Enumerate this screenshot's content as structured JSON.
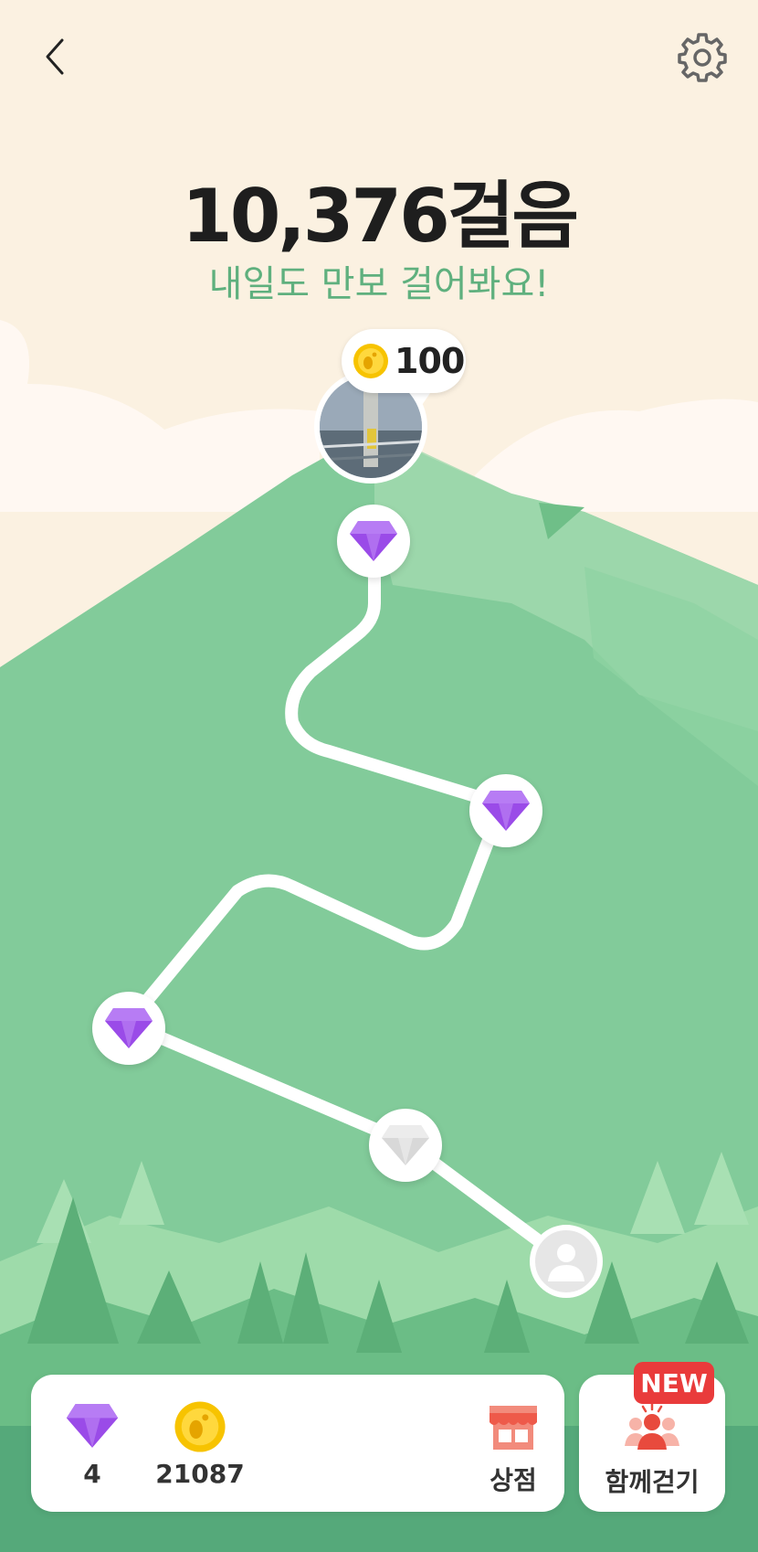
{
  "header": {
    "steps": "10,376걸음",
    "subtitle": "내일도 만보 걸어봐요!"
  },
  "reward_bubble": {
    "amount": "100"
  },
  "path_nodes": [
    {
      "type": "diamond",
      "state": "collected"
    },
    {
      "type": "diamond",
      "state": "collected"
    },
    {
      "type": "diamond",
      "state": "collected"
    },
    {
      "type": "diamond",
      "state": "locked"
    },
    {
      "type": "user",
      "state": "current"
    }
  ],
  "wallet": {
    "diamonds": "4",
    "coins": "21087",
    "shop_label": "상점"
  },
  "walk_together": {
    "label": "함께걷기",
    "badge": "NEW"
  },
  "icons": {
    "back": "chevron-left-icon",
    "settings": "gear-icon",
    "diamond": "diamond-icon",
    "coin": "footprint-coin-icon",
    "shop": "store-icon",
    "group": "people-icon"
  },
  "colors": {
    "sky": "#fbf1e1",
    "mountain": "#82cb9a",
    "accent_text": "#5fb07e",
    "diamond": "#9a4be8",
    "coin": "#f7c300",
    "badge": "#e93b3b"
  }
}
